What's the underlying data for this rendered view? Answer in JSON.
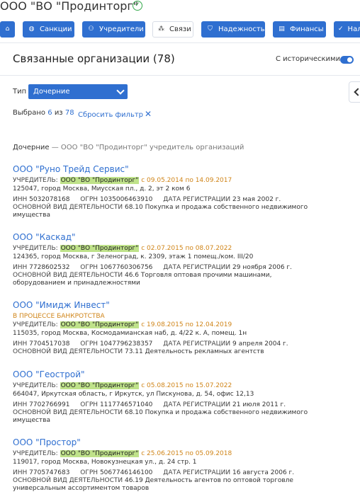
{
  "company_title": "ООО \"ВО \"Продинторг\"",
  "tabs": [
    {
      "label": "",
      "icon": "home-icon"
    },
    {
      "label": "Санкции",
      "icon": "globe-icon"
    },
    {
      "label": "Учредители",
      "icon": "people-icon"
    },
    {
      "label": "Связи",
      "icon": "network-icon"
    },
    {
      "label": "Надежность",
      "icon": "shield-icon"
    },
    {
      "label": "Финансы",
      "icon": "chart-icon"
    },
    {
      "label": "Нал",
      "icon": "tax-icon"
    }
  ],
  "panel": {
    "title": "Связанные организации (78)",
    "historic_label": "С историческими",
    "type_label": "Тип",
    "type_value": "Дочерние",
    "selected_text": "Выбрано",
    "selected_count": "6",
    "selected_of": "из",
    "selected_total": "78",
    "reset_label": "Сбросить фильтр",
    "desc_strong": "Дочерние",
    "desc_rest": " — ООО \"ВО \"Продинторг\" учредитель организаций"
  },
  "labels": {
    "founder": "УЧРЕДИТЕЛЬ:",
    "inn": "ИНН",
    "ogrn": "ОГРН",
    "reg": "ДАТА РЕГИСТРАЦИИ",
    "activity": "ОСНОВНОЙ ВИД ДЕЯТЕЛЬНОСТИ"
  },
  "orgs": [
    {
      "name": "ООО \"Руно Трейд Сервис\"",
      "founder": "ООО \"ВО \"Продинторг\"",
      "period": "с 09.05.2014 по 14.09.2017",
      "address": "125047, город Москва, Миусская пл., д. 2, эт 2 ком 6",
      "inn": "5032078168",
      "ogrn": "1035006463910",
      "reg": "23 мая 2002 г.",
      "activity": "68.10 Покупка и продажа собственного недвижимого имущества"
    },
    {
      "name": "ООО \"Каскад\"",
      "founder": "ООО \"ВО \"Продинторг\"",
      "period": "с 02.07.2015 по 08.07.2022",
      "address": "124365, город Москва, г Зеленоград, к. 2309, этаж 1 помещ./ком. III/20",
      "inn": "7728602532",
      "ogrn": "1067760306756",
      "reg": "29 ноября 2006 г.",
      "activity": "46.6 Торговля оптовая прочими машинами, оборудованием и принадлежностями"
    },
    {
      "name": "ООО \"Имидж Инвест\"",
      "status": "В ПРОЦЕССЕ БАНКРОТСТВА",
      "founder": "ООО \"ВО \"Продинторг\"",
      "period": "с 19.08.2015 по 12.04.2019",
      "address": "115035, город Москва, Космодамианская наб, д. 4/22 к. А, помещ. 1н",
      "inn": "7704517038",
      "ogrn": "1047796238357",
      "reg": "9 апреля 2004 г.",
      "activity": "73.11 Деятельность рекламных агентств"
    },
    {
      "name": "ООО \"Геострой\"",
      "founder": "ООО \"ВО \"Продинторг\"",
      "period": "с 05.08.2015 по 15.07.2022",
      "address": "664047, Иркутская область, г Иркутск, ул Пискунова, д. 54, офис 12,13",
      "inn": "7702766991",
      "ogrn": "1117746571040",
      "reg": "21 июля 2011 г.",
      "activity": "68.10 Покупка и продажа собственного недвижимого имущества"
    },
    {
      "name": "ООО \"Простор\"",
      "founder": "ООО \"ВО \"Продинторг\"",
      "period": "с 25.06.2015 по 05.09.2018",
      "address": "119017, город Москва, Новокузнецкая ул., д. 24 стр. 1",
      "inn": "7705747683",
      "ogrn": "5067746146100",
      "reg": "16 августа 2006 г.",
      "activity": "46.19 Деятельность агентов по оптовой торговле универсальным ассортиментом товаров"
    }
  ]
}
